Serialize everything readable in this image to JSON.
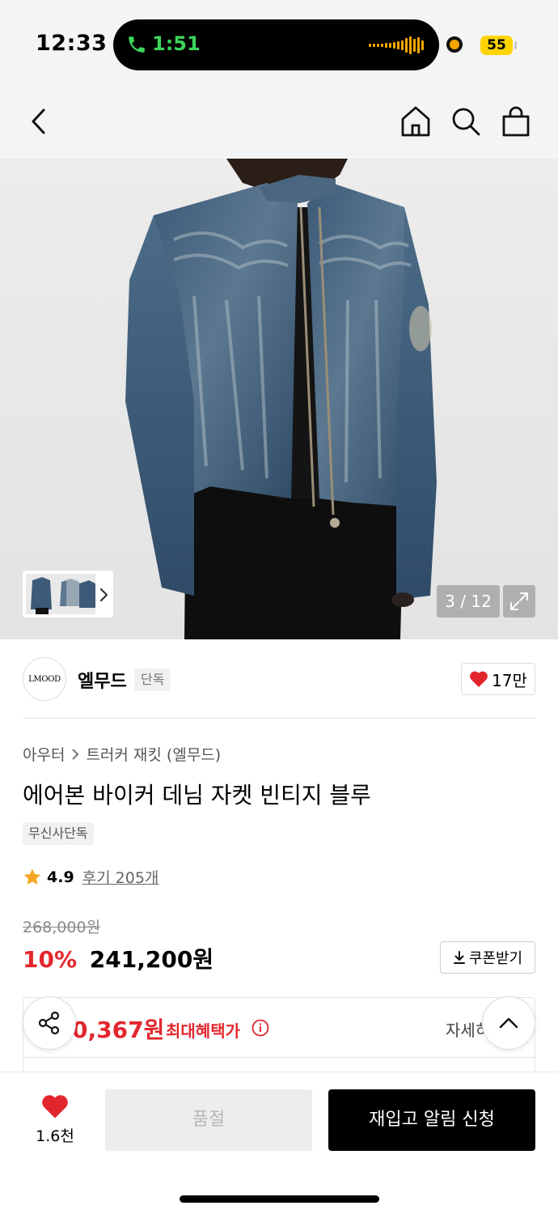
{
  "status_bar": {
    "time": "12:33",
    "call_duration": "1:51",
    "battery": "55",
    "colors": {
      "call": "#3cd45a",
      "battery": "#ffd400",
      "recording": "#f7a600"
    }
  },
  "nav": {
    "icons": [
      "back-arrow-icon",
      "home-icon",
      "search-icon",
      "shopping-bag-icon"
    ]
  },
  "gallery": {
    "counter": "3 / 12",
    "thumbnail_icon": "chevron-right-icon",
    "expand_icon": "expand-icon"
  },
  "brand": {
    "logo_text": "LMOOD",
    "name": "엘무드",
    "tag": "단독",
    "likes": "17만"
  },
  "product": {
    "breadcrumb": [
      "아우터",
      "트러커 재킷 (엘무드)"
    ],
    "name": "에어본 바이커 데님 자켓 빈티지 블루",
    "exclusive_tag": "무신사단독",
    "rating": "4.9",
    "reviews": "후기 205개",
    "original_price": "268,000원",
    "discount": "10%",
    "price": "241,200원",
    "coupon_label": "쿠폰받기",
    "colors": {
      "discount": "#e3262d",
      "star": "#f5a623"
    }
  },
  "benefit": {
    "amount": "0,367원",
    "label": "최대혜택가",
    "more": "자세히"
  },
  "bottom_bar": {
    "wish_count": "1.6천",
    "sold_out_label": "품절",
    "restock_label": "재입고 알림 신청"
  }
}
